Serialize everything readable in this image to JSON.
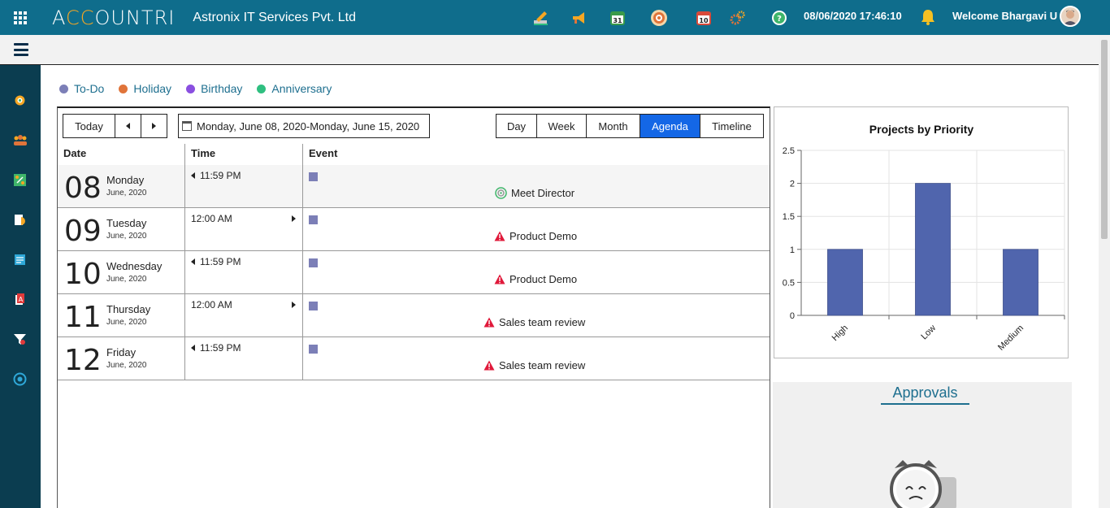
{
  "header": {
    "logo_text": "ACCOUNTRI",
    "company": "Astronix IT Services Pvt. Ltd",
    "datetime": "08/06/2020 17:46:10",
    "welcome": "Welcome Bhargavi U",
    "icons": [
      "task-edit-icon",
      "megaphone-icon",
      "calendar-31-icon",
      "target-icon",
      "calendar-10-icon",
      "gears-icon",
      "help-icon"
    ]
  },
  "legend": [
    {
      "label": "To-Do",
      "color": "#7c7fb7"
    },
    {
      "label": "Holiday",
      "color": "#e0743a"
    },
    {
      "label": "Birthday",
      "color": "#8a4fe0"
    },
    {
      "label": "Anniversary",
      "color": "#2fbf80"
    }
  ],
  "toolbar": {
    "today": "Today",
    "date_range": "Monday, June 08, 2020-Monday, June 15, 2020",
    "views": [
      "Day",
      "Week",
      "Month",
      "Agenda",
      "Timeline"
    ],
    "active_view": "Agenda"
  },
  "columns": {
    "date": "Date",
    "time": "Time",
    "event": "Event"
  },
  "agenda": [
    {
      "day": "08",
      "weekday": "Monday",
      "month": "June, 2020",
      "time": "11:59 PM",
      "arrow": "left",
      "event": "Meet Director",
      "event_icon": "target-icon"
    },
    {
      "day": "09",
      "weekday": "Tuesday",
      "month": "June, 2020",
      "time": "12:00 AM",
      "arrow": "right",
      "event": "Product Demo",
      "event_icon": "warning-icon"
    },
    {
      "day": "10",
      "weekday": "Wednesday",
      "month": "June, 2020",
      "time": "11:59 PM",
      "arrow": "left",
      "event": "Product Demo",
      "event_icon": "warning-icon"
    },
    {
      "day": "11",
      "weekday": "Thursday",
      "month": "June, 2020",
      "time": "12:00 AM",
      "arrow": "right",
      "event": "Sales team review",
      "event_icon": "warning-icon"
    },
    {
      "day": "12",
      "weekday": "Friday",
      "month": "June, 2020",
      "time": "11:59 PM",
      "arrow": "left",
      "event": "Sales team review",
      "event_icon": "warning-icon"
    }
  ],
  "chart_data": {
    "type": "bar",
    "title": "Projects by Priority",
    "categories": [
      "High",
      "Low",
      "Medium"
    ],
    "values": [
      1,
      2,
      1
    ],
    "ylim": [
      0,
      2.5
    ],
    "yticks": [
      "0",
      "0.5",
      "1",
      "1.5",
      "2",
      "2.5"
    ],
    "xlabel": "",
    "ylabel": "",
    "grid": true,
    "bar_color": "#5065ad"
  },
  "approvals": {
    "title": "Approvals"
  }
}
